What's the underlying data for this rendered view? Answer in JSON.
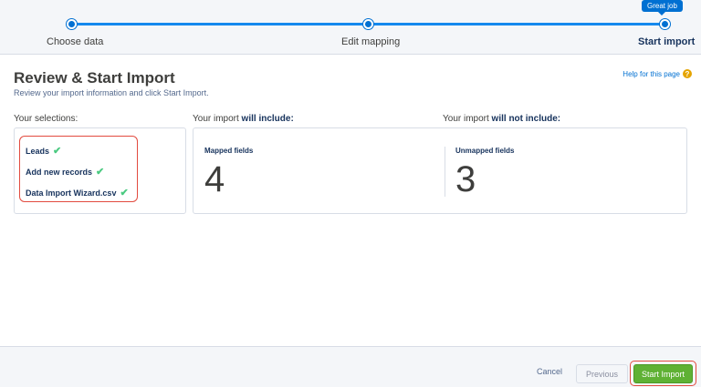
{
  "wizard": {
    "steps": [
      {
        "label": "Choose data"
      },
      {
        "label": "Edit mapping"
      },
      {
        "label": "Start import"
      }
    ],
    "tooltip": "Great job"
  },
  "header": {
    "title": "Review & Start Import",
    "subtitle": "Review your import information and click Start Import.",
    "help_link": "Help for this page",
    "help_icon": "?"
  },
  "selections": {
    "heading": "Your selections:",
    "items": [
      "Leads",
      "Add new records",
      "Data Import Wizard.csv"
    ],
    "check_icon": "✔"
  },
  "include": {
    "heading_prefix": "Your import ",
    "heading_bold": "will include:",
    "mapped_label": "Mapped fields",
    "mapped_count": "4"
  },
  "exclude": {
    "heading_prefix": "Your import ",
    "heading_bold": "will not include:",
    "unmapped_label": "Unmapped fields",
    "unmapped_count": "3"
  },
  "footer": {
    "cancel_label": "Cancel",
    "previous_label": "Previous",
    "start_label": "Start Import"
  },
  "colors": {
    "accent": "#0070d2",
    "success": "#5fb134",
    "highlight": "#e24b3f"
  }
}
